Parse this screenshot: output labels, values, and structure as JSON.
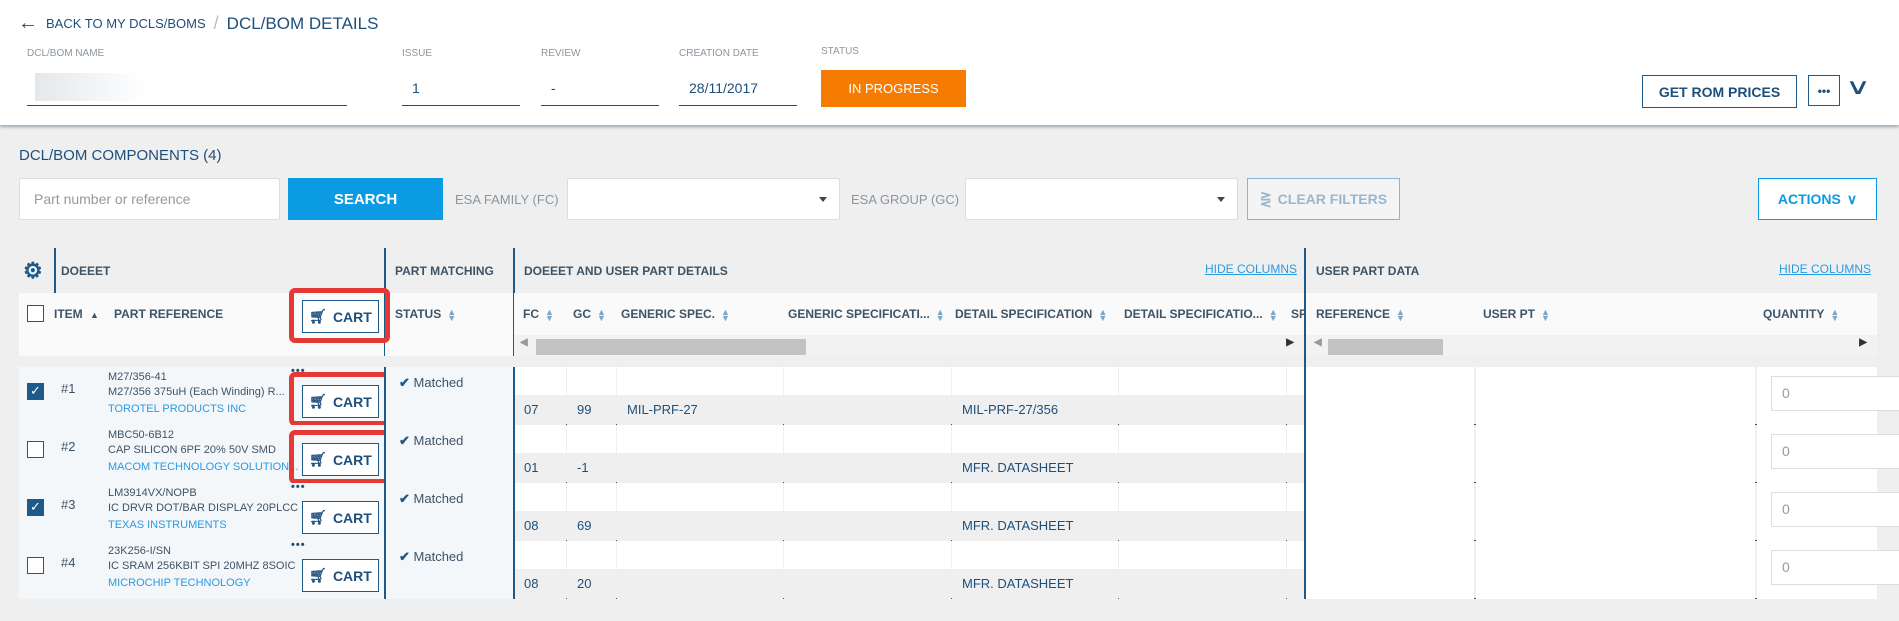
{
  "breadcrumb": {
    "back": "BACK TO MY DCLS/BOMS",
    "sep": "/",
    "current": "DCL/BOM DETAILS"
  },
  "fields": {
    "name_label": "DCL/BOM NAME",
    "issue_label": "ISSUE",
    "issue": "1",
    "review_label": "REVIEW",
    "review": "-",
    "date_label": "CREATION DATE",
    "date": "28/11/2017",
    "status_label": "STATUS",
    "status": "IN PROGRESS"
  },
  "header_actions": {
    "rom": "GET ROM PRICES",
    "more": "•••"
  },
  "components": {
    "title": "DCL/BOM COMPONENTS (4)",
    "search_placeholder": "Part number or reference",
    "search_btn": "SEARCH",
    "family_label": "ESA FAMILY (FC)",
    "group_label": "ESA GROUP (GC)",
    "clear": "CLEAR FILTERS",
    "actions": "ACTIONS"
  },
  "groups": {
    "doeeet": "DOEEET",
    "matching": "PART MATCHING",
    "details": "DOEEET AND USER PART DETAILS",
    "user": "USER PART DATA",
    "hide": "HIDE COLUMNS"
  },
  "columns": {
    "item": "ITEM",
    "part_ref": "PART REFERENCE",
    "cart": "CART",
    "status": "STATUS",
    "fc": "FC",
    "gc": "GC",
    "generic_spec": "GENERIC SPEC.",
    "generic_specification": "GENERIC SPECIFICATI...",
    "detail_spec": "DETAIL SPECIFICATION",
    "detail_specification": "DETAIL SPECIFICATIO...",
    "sp": "SP",
    "reference": "REFERENCE",
    "user_pt": "USER PT",
    "quantity": "QUANTITY"
  },
  "accent": {
    "primary": "#1d5a8a",
    "orange": "#f57c00",
    "search": "#0b9be3",
    "highlight": "#e53935"
  },
  "rows": [
    {
      "checked": true,
      "item": "#1",
      "part": "M27/356-41",
      "desc": "M27/356 375uH (Each Winding) R...",
      "maker": "TOROTEL PRODUCTS INC",
      "status": "Matched",
      "fc": "07",
      "gc": "99",
      "generic": "MIL-PRF-27",
      "detail": "MIL-PRF-27/356",
      "qty": "0",
      "highlighted": true,
      "menu": true
    },
    {
      "checked": false,
      "item": "#2",
      "part": "MBC50-6B12",
      "desc": "CAP SILICON 6PF 20% 50V SMD",
      "maker": "MACOM TECHNOLOGY SOLUTION...",
      "status": "Matched",
      "fc": "01",
      "gc": "-1",
      "generic": "",
      "detail": "MFR. DATASHEET",
      "qty": "0",
      "highlighted": true,
      "menu": false
    },
    {
      "checked": true,
      "item": "#3",
      "part": "LM3914VX/NOPB",
      "desc": "IC DRVR DOT/BAR DISPLAY 20PLCC",
      "maker": "TEXAS INSTRUMENTS",
      "status": "Matched",
      "fc": "08",
      "gc": "69",
      "generic": "",
      "detail": "MFR. DATASHEET",
      "qty": "0",
      "highlighted": false,
      "menu": true
    },
    {
      "checked": false,
      "item": "#4",
      "part": "23K256-I/SN",
      "desc": "IC SRAM 256KBIT SPI 20MHZ 8SOIC",
      "maker": "MICROCHIP TECHNOLOGY",
      "status": "Matched",
      "fc": "08",
      "gc": "20",
      "generic": "",
      "detail": "MFR. DATASHEET",
      "qty": "0",
      "highlighted": false,
      "menu": true
    }
  ]
}
